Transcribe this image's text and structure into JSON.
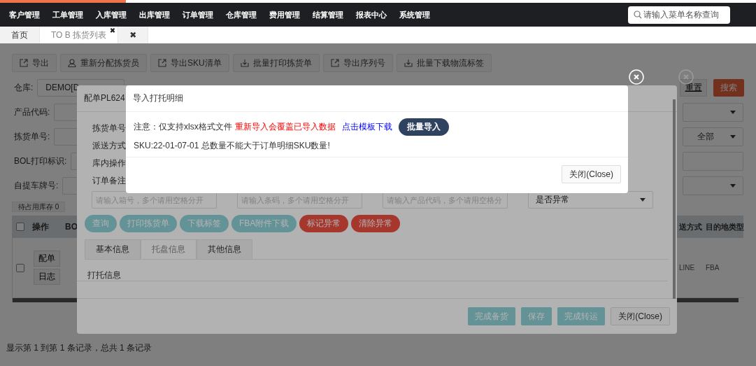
{
  "top_nav": {
    "items": [
      {
        "label": "客户管理"
      },
      {
        "label": "工单管理"
      },
      {
        "label": "入库管理"
      },
      {
        "label": "出库管理"
      },
      {
        "label": "订单管理"
      },
      {
        "label": "仓库管理"
      },
      {
        "label": "费用管理"
      },
      {
        "label": "结算管理"
      },
      {
        "label": "报表中心"
      },
      {
        "label": "系统管理"
      }
    ],
    "search": {
      "placeholder": "请输入菜单名称查询"
    }
  },
  "page_tabs": [
    {
      "label": "首页",
      "selected": false
    },
    {
      "label": "TO B 拣货列表",
      "selected": true,
      "close": "✖"
    },
    {
      "label": "✖",
      "selected": false
    }
  ],
  "toolbar": [
    {
      "label": "导出",
      "kind": "export"
    },
    {
      "label": "重新分配拣货员",
      "kind": "user"
    },
    {
      "label": "导出SKU清单",
      "kind": "export"
    },
    {
      "label": "批量打印拣货单",
      "kind": "download"
    },
    {
      "label": "导出序列号",
      "kind": "export"
    },
    {
      "label": "批量下载物流标签",
      "kind": "download"
    }
  ],
  "filters": {
    "warehouse": {
      "label": "仓库:",
      "value": "DEMO[D"
    },
    "reset": "重置",
    "search": "搜索",
    "rows": [
      {
        "label": "产品代码:",
        "control": {
          "kind": "select"
        }
      },
      {
        "label": "拣货单号:",
        "control": {
          "kind": "select",
          "value": "全部"
        }
      },
      {
        "label": "BOL打印标识:",
        "control": {
          "kind": "input"
        }
      },
      {
        "label": "自提车牌号:",
        "control": {
          "kind": "select"
        }
      }
    ]
  },
  "stats": [
    "待占用库存 0"
  ],
  "table": {
    "columns": [
      {
        "label": "操作"
      },
      {
        "label": "BO"
      },
      {
        "label": "送方式"
      },
      {
        "label": "目的地类型"
      }
    ],
    "header_checked": false,
    "rows": [
      {
        "checked": false,
        "actions": [
          "配单",
          "日志"
        ],
        "ship_method": "LINE",
        "destination_type": "FBA"
      }
    ]
  },
  "footer": "显示第 1 到第 1 条记录，总共 1 条记录",
  "pick_dialog": {
    "title": "配单PL624",
    "labels": [
      "拣货单号",
      "派送方式",
      "库内操作",
      "订单备注"
    ],
    "search_fields": [
      {
        "placeholder": "请输入箱号，多个请用空格分开"
      },
      {
        "placeholder": "请输入条码，多个请用空格分开"
      },
      {
        "placeholder": "请输入产品代码，多个请用空格分"
      }
    ],
    "select": {
      "value": "是否异常"
    },
    "actions": [
      {
        "label": "查询",
        "kind": "primary"
      },
      {
        "label": "打印拣货单",
        "kind": "primary"
      },
      {
        "label": "下载标签",
        "kind": "primary"
      },
      {
        "label": "FBA附件下载",
        "kind": "primary"
      },
      {
        "label": "标记异常",
        "kind": "danger"
      },
      {
        "label": "清除异常",
        "kind": "danger"
      }
    ],
    "tabs": [
      {
        "label": "基本信息",
        "selected": false
      },
      {
        "label": "托盘信息",
        "selected": true
      },
      {
        "label": "其他信息",
        "selected": false
      }
    ],
    "section": "打托信息",
    "footer_buttons": [
      {
        "label": "完成备货",
        "kind": "primary"
      },
      {
        "label": "保存",
        "kind": "primary"
      },
      {
        "label": "完成转运",
        "kind": "primary"
      },
      {
        "label": "关闭(Close)",
        "kind": "default"
      }
    ]
  },
  "import_dialog": {
    "title": "导入打托明细",
    "notice": {
      "text": "注意：仅支持xlsx格式文件",
      "warning": "重新导入会覆盖已导入数据",
      "link": "点击模板下载",
      "button": "批量导入"
    },
    "message": "SKU:22-01-07-01 总数量不能大于订单明细SKU数量!",
    "close": "关闭(Close)"
  }
}
